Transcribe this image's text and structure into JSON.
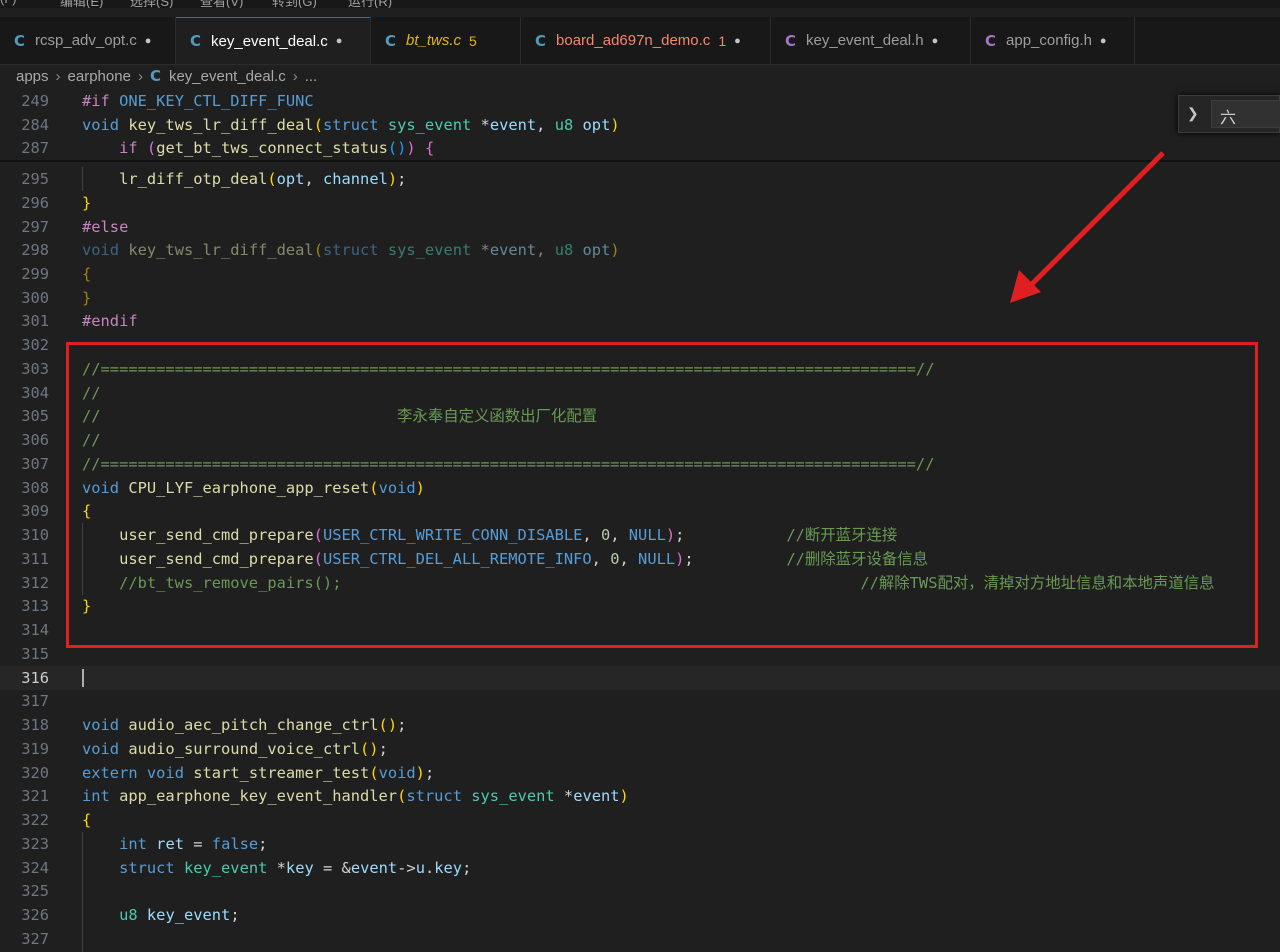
{
  "menu": [
    "(F)",
    "编辑(E)",
    "选择(S)",
    "查看(V)",
    "转到(G)",
    "运行(R)"
  ],
  "tabs": [
    {
      "name": "rcsp_adv_opt.c",
      "icon": "c-file-icon",
      "badge": "",
      "state": "modified"
    },
    {
      "name": "key_event_deal.c",
      "icon": "c-file-icon",
      "badge": "",
      "state": "active-modified"
    },
    {
      "name": "bt_tws.c",
      "icon": "c-file-icon",
      "badge": "5",
      "state": "warning"
    },
    {
      "name": "board_ad697n_demo.c",
      "icon": "c-file-icon",
      "badge": "1",
      "state": "error-modified"
    },
    {
      "name": "key_event_deal.h",
      "icon": "h-file-icon",
      "badge": "",
      "state": "modified"
    },
    {
      "name": "app_config.h",
      "icon": "h-file-icon",
      "badge": "",
      "state": "modified"
    }
  ],
  "breadcrumb": [
    "apps",
    "earphone",
    "key_event_deal.c",
    "..."
  ],
  "find_widget": {
    "value": "六"
  },
  "colors": {
    "accent": "#0078d4",
    "annotation": "#e02020",
    "editor_bg": "#1f1f1f"
  },
  "lines": [
    {
      "n": "249",
      "tokens": [
        [
          "pp",
          "#if"
        ],
        [
          "pl",
          " "
        ],
        [
          "mc",
          "ONE_KEY_CTL_DIFF_FUNC"
        ]
      ]
    },
    {
      "n": "284",
      "tokens": [
        [
          "kw",
          "void"
        ],
        [
          "pl",
          " "
        ],
        [
          "fn",
          "key_tws_lr_diff_deal"
        ],
        [
          "br",
          "("
        ],
        [
          "kw",
          "struct"
        ],
        [
          "pl",
          " "
        ],
        [
          "ty",
          "sys_event"
        ],
        [
          "pl",
          " *"
        ],
        [
          "pa",
          "event"
        ],
        [
          "pl",
          ", "
        ],
        [
          "ty",
          "u8"
        ],
        [
          "pl",
          " "
        ],
        [
          "pa",
          "opt"
        ],
        [
          "br",
          ")"
        ]
      ]
    },
    {
      "n": "287",
      "tokens": [
        [
          "pl",
          "    "
        ],
        [
          "kw2",
          "if"
        ],
        [
          "pl",
          " "
        ],
        [
          "br2",
          "("
        ],
        [
          "fn",
          "get_bt_tws_connect_status"
        ],
        [
          "br3",
          "()"
        ],
        [
          "br2",
          ")"
        ],
        [
          "pl",
          " "
        ],
        [
          "br2",
          "{"
        ]
      ]
    },
    {
      "n": "295",
      "tokens": [
        [
          "pl",
          "    "
        ],
        [
          "fn",
          "lr_diff_otp_deal"
        ],
        [
          "br",
          "("
        ],
        [
          "va",
          "opt"
        ],
        [
          "pl",
          ", "
        ],
        [
          "va",
          "channel"
        ],
        [
          "br",
          ")"
        ],
        [
          "pl",
          ";"
        ]
      ]
    },
    {
      "n": "296",
      "tokens": [
        [
          "br",
          "}"
        ]
      ]
    },
    {
      "n": "297",
      "tokens": [
        [
          "pp",
          "#else"
        ]
      ]
    },
    {
      "n": "298",
      "tokens": [
        [
          "kw dim",
          "void"
        ],
        [
          "pl dim",
          " "
        ],
        [
          "fn dim",
          "key_tws_lr_diff_deal"
        ],
        [
          "br dim",
          "("
        ],
        [
          "kw dim",
          "struct"
        ],
        [
          "pl dim",
          " "
        ],
        [
          "ty dim",
          "sys_event"
        ],
        [
          "pl dim",
          " *"
        ],
        [
          "pa dim",
          "event"
        ],
        [
          "pl dim",
          ", "
        ],
        [
          "ty dim",
          "u8"
        ],
        [
          "pl dim",
          " "
        ],
        [
          "pa dim",
          "opt"
        ],
        [
          "br dim",
          ")"
        ]
      ]
    },
    {
      "n": "299",
      "tokens": [
        [
          "br dim",
          "{"
        ]
      ]
    },
    {
      "n": "300",
      "tokens": [
        [
          "br dim",
          "}"
        ]
      ]
    },
    {
      "n": "301",
      "tokens": [
        [
          "pp",
          "#endif"
        ]
      ]
    },
    {
      "n": "302",
      "tokens": []
    },
    {
      "n": "303",
      "tokens": [
        [
          "cm",
          "//========================================================================================//"
        ]
      ]
    },
    {
      "n": "304",
      "tokens": [
        [
          "cm",
          "//"
        ]
      ]
    },
    {
      "n": "305",
      "tokens": [
        [
          "cm",
          "//                                李永奉自定义函数出厂化配置"
        ]
      ]
    },
    {
      "n": "306",
      "tokens": [
        [
          "cm",
          "//"
        ]
      ]
    },
    {
      "n": "307",
      "tokens": [
        [
          "cm",
          "//========================================================================================//"
        ]
      ]
    },
    {
      "n": "308",
      "tokens": [
        [
          "kw",
          "void"
        ],
        [
          "pl",
          " "
        ],
        [
          "fn",
          "CPU_LYF_earphone_app_reset"
        ],
        [
          "br",
          "("
        ],
        [
          "kw",
          "void"
        ],
        [
          "br",
          ")"
        ]
      ]
    },
    {
      "n": "309",
      "tokens": [
        [
          "br",
          "{"
        ]
      ]
    },
    {
      "n": "310",
      "tokens": [
        [
          "pl",
          "    "
        ],
        [
          "fn",
          "user_send_cmd_prepare"
        ],
        [
          "br2",
          "("
        ],
        [
          "mc",
          "USER_CTRL_WRITE_CONN_DISABLE"
        ],
        [
          "pl",
          ", "
        ],
        [
          "nm",
          "0"
        ],
        [
          "pl",
          ", "
        ],
        [
          "mc",
          "NULL"
        ],
        [
          "br2",
          ")"
        ],
        [
          "pl",
          ";           "
        ],
        [
          "cm",
          "//断开蓝牙连接"
        ]
      ]
    },
    {
      "n": "311",
      "tokens": [
        [
          "pl",
          "    "
        ],
        [
          "fn",
          "user_send_cmd_prepare"
        ],
        [
          "br2",
          "("
        ],
        [
          "mc",
          "USER_CTRL_DEL_ALL_REMOTE_INFO"
        ],
        [
          "pl",
          ", "
        ],
        [
          "nm",
          "0"
        ],
        [
          "pl",
          ", "
        ],
        [
          "mc",
          "NULL"
        ],
        [
          "br2",
          ")"
        ],
        [
          "pl",
          ";          "
        ],
        [
          "cm",
          "//删除蓝牙设备信息"
        ]
      ]
    },
    {
      "n": "312",
      "tokens": [
        [
          "pl",
          "    "
        ],
        [
          "cm",
          "//bt_tws_remove_pairs();                                                        //解除TWS配对，清掉对方地址信息和本地声道信息"
        ]
      ]
    },
    {
      "n": "313",
      "tokens": [
        [
          "br",
          "}"
        ]
      ]
    },
    {
      "n": "314",
      "tokens": []
    },
    {
      "n": "315",
      "tokens": []
    },
    {
      "n": "316",
      "tokens": [],
      "current": true
    },
    {
      "n": "317",
      "tokens": []
    },
    {
      "n": "318",
      "tokens": [
        [
          "kw",
          "void"
        ],
        [
          "pl",
          " "
        ],
        [
          "fn",
          "audio_aec_pitch_change_ctrl"
        ],
        [
          "br",
          "()"
        ],
        [
          "pl",
          ";"
        ]
      ]
    },
    {
      "n": "319",
      "tokens": [
        [
          "kw",
          "void"
        ],
        [
          "pl",
          " "
        ],
        [
          "fn",
          "audio_surround_voice_ctrl"
        ],
        [
          "br",
          "()"
        ],
        [
          "pl",
          ";"
        ]
      ]
    },
    {
      "n": "320",
      "tokens": [
        [
          "kw",
          "extern"
        ],
        [
          "pl",
          " "
        ],
        [
          "kw",
          "void"
        ],
        [
          "pl",
          " "
        ],
        [
          "fn",
          "start_streamer_test"
        ],
        [
          "br",
          "("
        ],
        [
          "kw",
          "void"
        ],
        [
          "br",
          ")"
        ],
        [
          "pl",
          ";"
        ]
      ]
    },
    {
      "n": "321",
      "tokens": [
        [
          "kw",
          "int"
        ],
        [
          "pl",
          " "
        ],
        [
          "fn",
          "app_earphone_key_event_handler"
        ],
        [
          "br",
          "("
        ],
        [
          "kw",
          "struct"
        ],
        [
          "pl",
          " "
        ],
        [
          "ty",
          "sys_event"
        ],
        [
          "pl",
          " *"
        ],
        [
          "pa",
          "event"
        ],
        [
          "br",
          ")"
        ]
      ]
    },
    {
      "n": "322",
      "tokens": [
        [
          "br",
          "{"
        ]
      ]
    },
    {
      "n": "323",
      "tokens": [
        [
          "pl",
          "    "
        ],
        [
          "kw",
          "int"
        ],
        [
          "pl",
          " "
        ],
        [
          "va",
          "ret"
        ],
        [
          "pl",
          " = "
        ],
        [
          "kw",
          "false"
        ],
        [
          "pl",
          ";"
        ]
      ]
    },
    {
      "n": "324",
      "tokens": [
        [
          "pl",
          "    "
        ],
        [
          "kw",
          "struct"
        ],
        [
          "pl",
          " "
        ],
        [
          "ty",
          "key_event"
        ],
        [
          "pl",
          " *"
        ],
        [
          "va",
          "key"
        ],
        [
          "pl",
          " = &"
        ],
        [
          "va",
          "event"
        ],
        [
          "pl",
          "->"
        ],
        [
          "va",
          "u"
        ],
        [
          "pl",
          "."
        ],
        [
          "va",
          "key"
        ],
        [
          "pl",
          ";"
        ]
      ]
    },
    {
      "n": "325",
      "tokens": []
    },
    {
      "n": "326",
      "tokens": [
        [
          "pl",
          "    "
        ],
        [
          "ty",
          "u8"
        ],
        [
          "pl",
          " "
        ],
        [
          "va",
          "key_event"
        ],
        [
          "pl",
          ";"
        ]
      ]
    },
    {
      "n": "327",
      "tokens": []
    }
  ]
}
